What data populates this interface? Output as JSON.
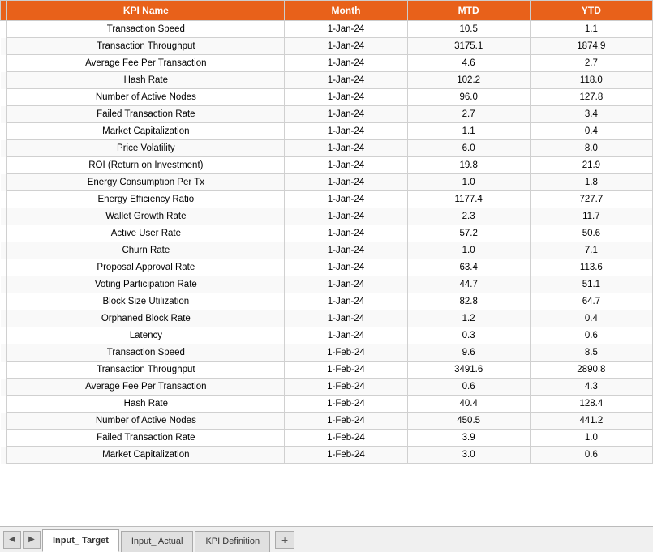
{
  "header": {
    "col_margin": "",
    "col_kpi": "KPI Name",
    "col_month": "Month",
    "col_mtd": "MTD",
    "col_ytd": "YTD"
  },
  "rows": [
    {
      "kpi": "Transaction Speed",
      "month": "1-Jan-24",
      "mtd": "10.5",
      "ytd": "1.1",
      "marker": false
    },
    {
      "kpi": "Transaction Throughput",
      "month": "1-Jan-24",
      "mtd": "3175.1",
      "ytd": "1874.9",
      "marker": false
    },
    {
      "kpi": "Average Fee Per Transaction",
      "month": "1-Jan-24",
      "mtd": "4.6",
      "ytd": "2.7",
      "marker": false
    },
    {
      "kpi": "Hash Rate",
      "month": "1-Jan-24",
      "mtd": "102.2",
      "ytd": "118.0",
      "marker": false
    },
    {
      "kpi": "Number of Active Nodes",
      "month": "1-Jan-24",
      "mtd": "96.0",
      "ytd": "127.8",
      "marker": false
    },
    {
      "kpi": "Failed Transaction Rate",
      "month": "1-Jan-24",
      "mtd": "2.7",
      "ytd": "3.4",
      "marker": false
    },
    {
      "kpi": "Market Capitalization",
      "month": "1-Jan-24",
      "mtd": "1.1",
      "ytd": "0.4",
      "marker": false
    },
    {
      "kpi": "Price Volatility",
      "month": "1-Jan-24",
      "mtd": "6.0",
      "ytd": "8.0",
      "marker": true
    },
    {
      "kpi": "ROI (Return on Investment)",
      "month": "1-Jan-24",
      "mtd": "19.8",
      "ytd": "21.9",
      "marker": false
    },
    {
      "kpi": "Energy Consumption Per Tx",
      "month": "1-Jan-24",
      "mtd": "1.0",
      "ytd": "1.8",
      "marker": false
    },
    {
      "kpi": "Energy Efficiency Ratio",
      "month": "1-Jan-24",
      "mtd": "1177.4",
      "ytd": "727.7",
      "marker": false
    },
    {
      "kpi": "Wallet Growth Rate",
      "month": "1-Jan-24",
      "mtd": "2.3",
      "ytd": "11.7",
      "marker": false
    },
    {
      "kpi": "Active User Rate",
      "month": "1-Jan-24",
      "mtd": "57.2",
      "ytd": "50.6",
      "marker": false
    },
    {
      "kpi": "Churn Rate",
      "month": "1-Jan-24",
      "mtd": "1.0",
      "ytd": "7.1",
      "marker": false
    },
    {
      "kpi": "Proposal Approval Rate",
      "month": "1-Jan-24",
      "mtd": "63.4",
      "ytd": "113.6",
      "marker": false
    },
    {
      "kpi": "Voting Participation Rate",
      "month": "1-Jan-24",
      "mtd": "44.7",
      "ytd": "51.1",
      "marker": false
    },
    {
      "kpi": "Block Size Utilization",
      "month": "1-Jan-24",
      "mtd": "82.8",
      "ytd": "64.7",
      "marker": false
    },
    {
      "kpi": "Orphaned Block Rate",
      "month": "1-Jan-24",
      "mtd": "1.2",
      "ytd": "0.4",
      "marker": false
    },
    {
      "kpi": "Latency",
      "month": "1-Jan-24",
      "mtd": "0.3",
      "ytd": "0.6",
      "marker": false
    },
    {
      "kpi": "Transaction Speed",
      "month": "1-Feb-24",
      "mtd": "9.6",
      "ytd": "8.5",
      "marker": false
    },
    {
      "kpi": "Transaction Throughput",
      "month": "1-Feb-24",
      "mtd": "3491.6",
      "ytd": "2890.8",
      "marker": false
    },
    {
      "kpi": "Average Fee Per Transaction",
      "month": "1-Feb-24",
      "mtd": "0.6",
      "ytd": "4.3",
      "marker": false
    },
    {
      "kpi": "Hash Rate",
      "month": "1-Feb-24",
      "mtd": "40.4",
      "ytd": "128.4",
      "marker": false
    },
    {
      "kpi": "Number of Active Nodes",
      "month": "1-Feb-24",
      "mtd": "450.5",
      "ytd": "441.2",
      "marker": false
    },
    {
      "kpi": "Failed Transaction Rate",
      "month": "1-Feb-24",
      "mtd": "3.9",
      "ytd": "1.0",
      "marker": false
    },
    {
      "kpi": "Market Capitalization",
      "month": "1-Feb-24",
      "mtd": "3.0",
      "ytd": "0.6",
      "marker": false
    }
  ],
  "tabs": [
    {
      "label": "Input_ Target",
      "active": true
    },
    {
      "label": "Input_ Actual",
      "active": false
    },
    {
      "label": "KPI Definition",
      "active": false
    }
  ],
  "tab_add": "+",
  "nav_prev": "◀",
  "nav_next": "▶"
}
